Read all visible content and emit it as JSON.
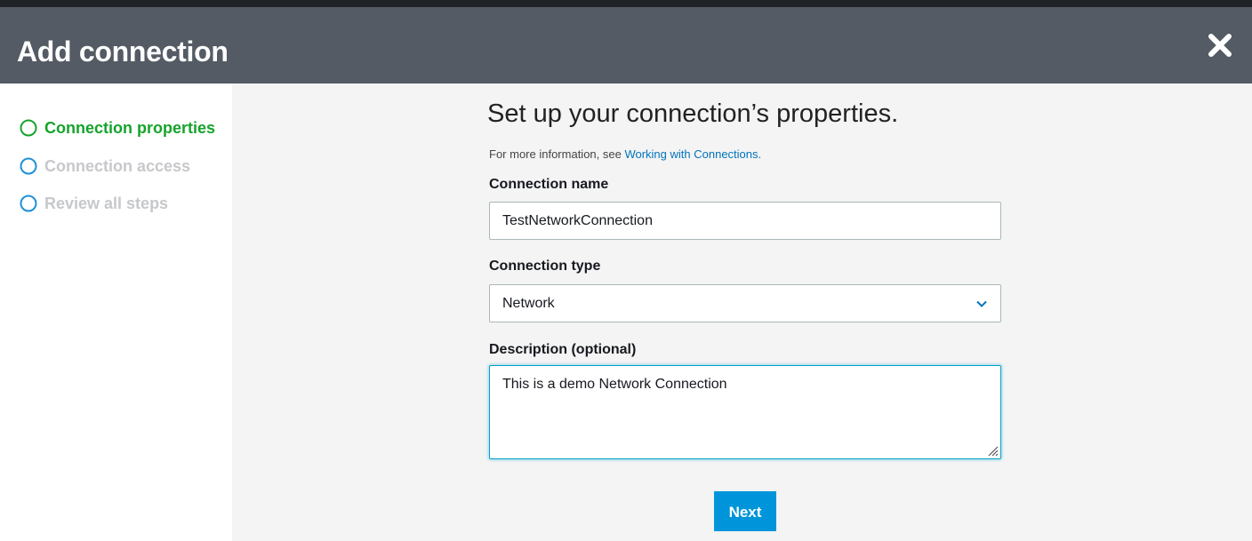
{
  "dialog": {
    "title": "Add connection"
  },
  "steps": [
    {
      "label": "Connection properties",
      "state": "active"
    },
    {
      "label": "Connection access",
      "state": "inactive"
    },
    {
      "label": "Review all steps",
      "state": "inactive"
    }
  ],
  "form": {
    "heading": "Set up your connection’s properties.",
    "info_prefix": "For more information, see ",
    "info_link": "Working with Connections.",
    "name_label": "Connection name",
    "name_value": "TestNetworkConnection",
    "type_label": "Connection type",
    "type_value": "Network",
    "description_label": "Description (optional)",
    "description_value": "This is a demo Network Connection",
    "next_label": "Next"
  },
  "icons": {
    "close": "close-icon",
    "step": "circle-icon",
    "dropdown": "chevron-down-icon",
    "resize": "resize-grip-icon"
  },
  "colors": {
    "header_bg": "#545b64",
    "active_step": "#16a32c",
    "inactive_step": "#c6c8cb",
    "step_circle": "#1e90d6",
    "link": "#0073bb",
    "primary_button": "#0095da",
    "focus_border": "#00a1c9"
  }
}
